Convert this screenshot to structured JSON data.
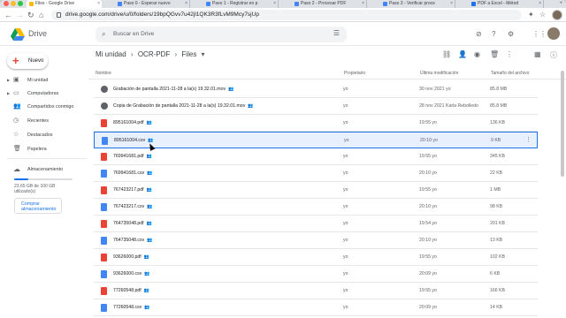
{
  "browser": {
    "tabs": [
      {
        "label": "Files - Google Drive",
        "color": "#fbbc04"
      },
      {
        "label": "Paso 0 - Esperar nuevo",
        "color": "#4285f4"
      },
      {
        "label": "Paso 1 - Registrar en p",
        "color": "#4285f4"
      },
      {
        "label": "Paso 2 - Procesar PDF",
        "color": "#4285f4"
      },
      {
        "label": "Paso 3 - Verificar proce",
        "color": "#4285f4"
      },
      {
        "label": "PDF a Excel - Métod",
        "color": "#1a73e8"
      }
    ],
    "url": "drive.google.com/drive/u/0/folders/19bpQGvv7u42jl1QK3R3fLvM9Mcy7sjUp",
    "nav": {
      "back_icon": "back-arrow-icon",
      "forward_icon": "forward-arrow-icon",
      "reload_icon": "reload-icon",
      "home_icon": "home-icon"
    }
  },
  "app": {
    "name": "Drive",
    "search_placeholder": "Buscar en Drive"
  },
  "sidebar": {
    "new_label": "Nuevo",
    "items": [
      {
        "label": "Mi unidad",
        "icon": "drive-icon",
        "expandable": true
      },
      {
        "label": "Computadoras",
        "icon": "computer-icon",
        "expandable": true
      },
      {
        "label": "Compartidos conmigo",
        "icon": "people-icon",
        "expandable": false
      },
      {
        "label": "Recientes",
        "icon": "clock-icon",
        "expandable": false
      },
      {
        "label": "Destacados",
        "icon": "star-icon",
        "expandable": false
      },
      {
        "label": "Papelera",
        "icon": "trash-icon",
        "expandable": false
      }
    ],
    "storage": {
      "label": "Almacenamiento",
      "used_text": "23.65 GB de 100 GB utilizado(s)",
      "used_fraction": 0.2365,
      "buy_label": "Comprar almacenamiento"
    }
  },
  "breadcrumb": {
    "items": [
      "Mi unidad",
      "OCR-PDF",
      "Files"
    ]
  },
  "table": {
    "headers": {
      "name": "Nombre",
      "owner": "Propietario",
      "modified": "Última modificación",
      "size": "Tamaño del archivo"
    },
    "rows": [
      {
        "name": "Grabación de pantalla 2021-11-28 a la(s) 19.32.01.mov",
        "type": "video",
        "shared": true,
        "owner": "yo",
        "modified": "30 nov 2021 yo",
        "size": "85.8 MB",
        "selected": false
      },
      {
        "name": "Copia de Grabación de pantalla 2021-11-28 a la(s) 19.32.01.mov",
        "type": "video",
        "shared": true,
        "owner": "yo",
        "modified": "28 nov 2021 Karla Rebolledo",
        "size": "85.8 MB",
        "selected": false
      },
      {
        "name": "895161004.pdf",
        "type": "pdf",
        "shared": true,
        "owner": "yo",
        "modified": "19:55 yo",
        "size": "136 KB",
        "selected": false
      },
      {
        "name": "895161004.csv",
        "type": "csv",
        "shared": true,
        "owner": "yo",
        "modified": "20:10 yo",
        "size": "9 KB",
        "selected": true
      },
      {
        "name": "769941681.pdf",
        "type": "pdf",
        "shared": true,
        "owner": "yo",
        "modified": "19:55 yo",
        "size": "345 KB",
        "selected": false
      },
      {
        "name": "769941681.csv",
        "type": "csv",
        "shared": true,
        "owner": "yo",
        "modified": "20:10 yo",
        "size": "22 KB",
        "selected": false
      },
      {
        "name": "767423217.pdf",
        "type": "pdf",
        "shared": true,
        "owner": "yo",
        "modified": "19:55 yo",
        "size": "1 MB",
        "selected": false
      },
      {
        "name": "767423217.csv",
        "type": "csv",
        "shared": true,
        "owner": "yo",
        "modified": "20:10 yo",
        "size": "98 KB",
        "selected": false
      },
      {
        "name": "764735048.pdf",
        "type": "pdf",
        "shared": true,
        "owner": "yo",
        "modified": "19:54 yo",
        "size": "201 KB",
        "selected": false
      },
      {
        "name": "764735048.csv",
        "type": "csv",
        "shared": true,
        "owner": "yo",
        "modified": "20:10 yo",
        "size": "13 KB",
        "selected": false
      },
      {
        "name": "93626000.pdf",
        "type": "pdf",
        "shared": true,
        "owner": "yo",
        "modified": "19:55 yo",
        "size": "102 KB",
        "selected": false
      },
      {
        "name": "93626000.csv",
        "type": "csv",
        "shared": true,
        "owner": "yo",
        "modified": "20:09 yo",
        "size": "6 KB",
        "selected": false
      },
      {
        "name": "77260548.pdf",
        "type": "pdf",
        "shared": true,
        "owner": "yo",
        "modified": "19:55 yo",
        "size": "166 KB",
        "selected": false
      },
      {
        "name": "77260548.csv",
        "type": "csv",
        "shared": true,
        "owner": "yo",
        "modified": "20:09 yo",
        "size": "14 KB",
        "selected": false
      }
    ]
  },
  "colors": {
    "accent": "#1a73e8",
    "selected_bg": "#e8f0fe",
    "pdf": "#ea4335",
    "csv": "#4285f4"
  }
}
